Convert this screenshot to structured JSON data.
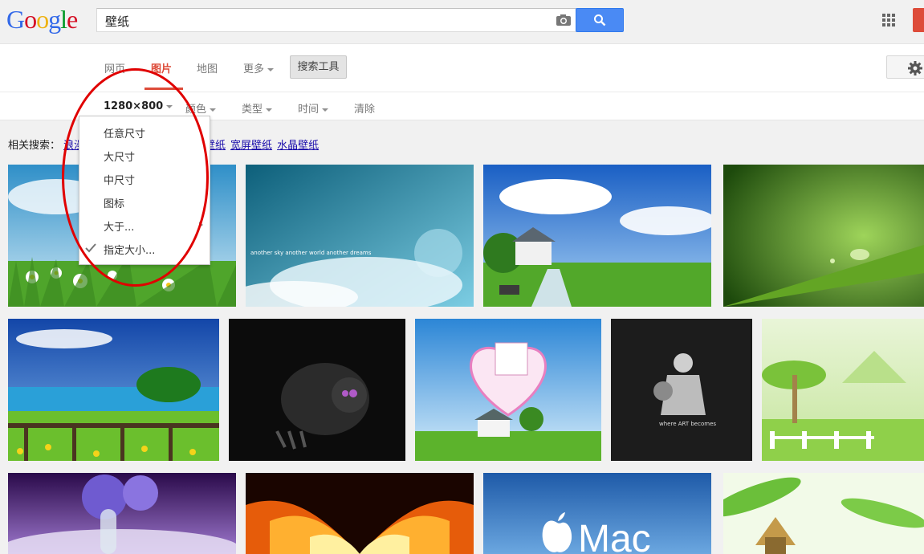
{
  "header": {
    "logo_letters": [
      "G",
      "o",
      "o",
      "g",
      "l",
      "e"
    ],
    "logo_colors": [
      "#3369e8",
      "#d50f25",
      "#eeb211",
      "#3369e8",
      "#009925",
      "#d50f25"
    ],
    "search_query": "壁纸",
    "icons": [
      "camera-icon",
      "search-icon",
      "apps-grid-icon"
    ]
  },
  "nav": {
    "web": "网页",
    "images": "图片",
    "maps": "地图",
    "more": "更多",
    "search_tools": "搜索工具",
    "active_color": "#dd4b39"
  },
  "filters": {
    "size": "1280×800",
    "color": "颜色",
    "type": "类型",
    "time": "时间",
    "clear": "清除"
  },
  "size_menu": {
    "items": [
      "任意尺寸",
      "大尺寸",
      "中尺寸",
      "图标",
      "大于...",
      "指定大小..."
    ],
    "checked_index": 5
  },
  "related": {
    "label": "相关搜索：",
    "hidden_link": "浪漫",
    "links": [
      "风景壁纸",
      "宽屏壁纸",
      "水晶壁纸"
    ]
  },
  "images": {
    "row1": [
      "daisy-meadow",
      "cloudy-sky-fantasy",
      "house-on-lawn",
      "green-leaf-dewdrop"
    ],
    "row2": [
      "lake-landscape",
      "dark-creature",
      "heart-calendar",
      "basketball-player",
      "cartoon-island"
    ],
    "row3": [
      "purple-planets",
      "fire-burst",
      "apple-mac",
      "tropical-hut"
    ],
    "mac_text": "Mac",
    "sky_caption": "another sky another world another dreams",
    "player_caption": "where ART becomes"
  }
}
